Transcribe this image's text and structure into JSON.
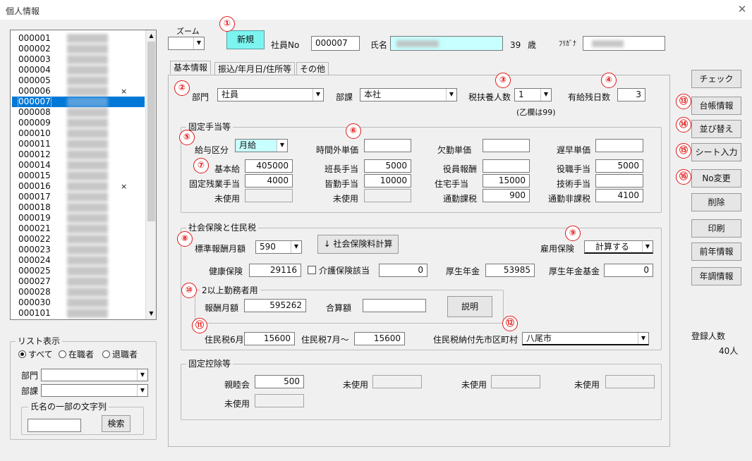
{
  "window": {
    "title": "個人情報"
  },
  "header": {
    "zoom_label": "ズーム",
    "zoom_value": "",
    "new_button": "新規",
    "emp_no_label": "社員No",
    "emp_no": "000007",
    "name_label": "氏名",
    "age": "39",
    "age_unit": "歳",
    "furigana_label": "ﾌﾘｶﾞﾅ"
  },
  "tabs": [
    "基本情報",
    "振込/年月日/住所等",
    "その他"
  ],
  "employee_list": [
    {
      "no": "000001",
      "mark": ""
    },
    {
      "no": "000002",
      "mark": ""
    },
    {
      "no": "000003",
      "mark": ""
    },
    {
      "no": "000004",
      "mark": ""
    },
    {
      "no": "000005",
      "mark": ""
    },
    {
      "no": "000006",
      "mark": "×"
    },
    {
      "no": "000007",
      "mark": "",
      "selected": true
    },
    {
      "no": "000008",
      "mark": ""
    },
    {
      "no": "000009",
      "mark": ""
    },
    {
      "no": "000010",
      "mark": ""
    },
    {
      "no": "000011",
      "mark": ""
    },
    {
      "no": "000012",
      "mark": ""
    },
    {
      "no": "000014",
      "mark": ""
    },
    {
      "no": "000015",
      "mark": ""
    },
    {
      "no": "000016",
      "mark": "×"
    },
    {
      "no": "000017",
      "mark": ""
    },
    {
      "no": "000018",
      "mark": ""
    },
    {
      "no": "000019",
      "mark": ""
    },
    {
      "no": "000021",
      "mark": ""
    },
    {
      "no": "000022",
      "mark": ""
    },
    {
      "no": "000023",
      "mark": ""
    },
    {
      "no": "000024",
      "mark": ""
    },
    {
      "no": "000025",
      "mark": ""
    },
    {
      "no": "000027",
      "mark": ""
    },
    {
      "no": "000028",
      "mark": ""
    },
    {
      "no": "000030",
      "mark": ""
    },
    {
      "no": "000101",
      "mark": ""
    }
  ],
  "list_filter": {
    "title": "リスト表示",
    "all": "すべて",
    "active": "在職者",
    "retired": "退職者",
    "dept_label": "部門",
    "section_label": "部課",
    "name_search_title": "氏名の一部の文字列",
    "search_button": "検索"
  },
  "basic": {
    "dept_label": "部門",
    "dept_value": "社員",
    "section_label": "部課",
    "section_value": "本社",
    "dependents_label": "税扶養人数",
    "dependents_value": "1",
    "otsu_note": "(乙欄は99)",
    "paid_leave_label": "有給残日数",
    "paid_leave_value": "3"
  },
  "fixed_allowance": {
    "title": "固定手当等",
    "pay_type_label": "給与区分",
    "pay_type_value": "月給",
    "overtime_rate_label": "時間外単価",
    "overtime_rate": "",
    "absence_rate_label": "欠勤単価",
    "absence_rate": "",
    "late_rate_label": "遅早単価",
    "late_rate": "",
    "base_pay_label": "基本給",
    "base_pay": "405000",
    "leader_label": "班長手当",
    "leader": "5000",
    "officer_label": "役員報酬",
    "officer": "",
    "position_label": "役職手当",
    "position": "5000",
    "fixed_ot_label": "固定残業手当",
    "fixed_ot": "4000",
    "attendance_label": "皆勤手当",
    "attendance": "10000",
    "housing_label": "住宅手当",
    "housing": "15000",
    "skill_label": "技術手当",
    "skill": "",
    "unused1_label": "未使用",
    "unused2_label": "未使用",
    "commute_tax_label": "通勤課税",
    "commute_tax": "900",
    "commute_nontax_label": "通勤非課税",
    "commute_nontax": "4100"
  },
  "insurance": {
    "title": "社会保険と住民税",
    "std_monthly_label": "標準報酬月額",
    "std_monthly_value": "590",
    "calc_button": "↓ 社会保険料計算",
    "employment_label": "雇用保険",
    "employment_value": "計算する",
    "health_label": "健康保険",
    "health": "29116",
    "care_label": "介護保険該当",
    "care": "0",
    "pension_label": "厚生年金",
    "pension": "53985",
    "pension_fund_label": "厚生年金基金",
    "pension_fund": "0",
    "multi_title": "2以上勤務者用",
    "remuneration_label": "報酬月額",
    "remuneration": "595262",
    "total_label": "合算額",
    "total": "",
    "explain_button": "説明",
    "resident_jun_label": "住民税6月",
    "resident_jun": "15600",
    "resident_jul_label": "住民税7月～",
    "resident_jul": "15600",
    "municipality_label": "住民税納付先市区町村",
    "municipality_value": "八尾市"
  },
  "fixed_deduction": {
    "title": "固定控除等",
    "social_label": "親睦会",
    "social": "500",
    "unused_label": "未使用"
  },
  "side_buttons": [
    "チェック",
    "台帳情報",
    "並び替え",
    "シート入力",
    "No変更",
    "削除",
    "印刷",
    "前年情報",
    "年調情報"
  ],
  "registered": {
    "label": "登録人数",
    "count": "40人"
  },
  "markers": [
    "①",
    "②",
    "③",
    "④",
    "⑤",
    "⑥",
    "⑦",
    "⑧",
    "⑨",
    "⑩",
    "⑪",
    "⑫",
    "⑬",
    "⑭",
    "⑮",
    "⑯"
  ],
  "colors": {
    "accent_cyan": "#c8ffff",
    "marker_red": "#e01818",
    "selection_blue": "#0078d7"
  }
}
